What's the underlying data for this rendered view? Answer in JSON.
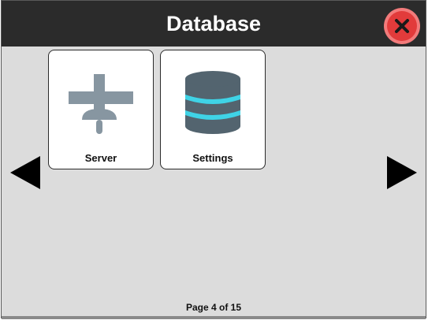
{
  "window": {
    "title": "Database"
  },
  "toolbar": {
    "close_icon": "close-icon"
  },
  "tiles": [
    {
      "label": "Server",
      "icon": "server-icon"
    },
    {
      "label": "Settings",
      "icon": "database-icon"
    }
  ],
  "pagination": {
    "text": "Page 4 of 15",
    "current": 4,
    "total": 15
  },
  "colors": {
    "titlebar": "#2b2b2b",
    "background": "#dcdcdc",
    "close_button": "#e23b3b",
    "icon_gray": "#8796a1",
    "database_body": "#53646f",
    "database_stripe": "#3fd3e6"
  }
}
